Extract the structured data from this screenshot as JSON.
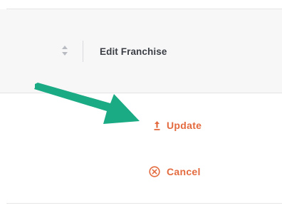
{
  "table": {
    "column_header": "Edit Franchise"
  },
  "actions": {
    "update_label": "Update",
    "cancel_label": "Cancel"
  },
  "colors": {
    "accent": "#e36b3f",
    "arrow": "#1aab84",
    "header_bg": "#f7f7f8",
    "header_text": "#3b3f45"
  },
  "icons": {
    "sort": "sort-icon",
    "update": "upload-icon",
    "cancel": "cancel-circle-icon",
    "annotation": "green-arrow"
  }
}
